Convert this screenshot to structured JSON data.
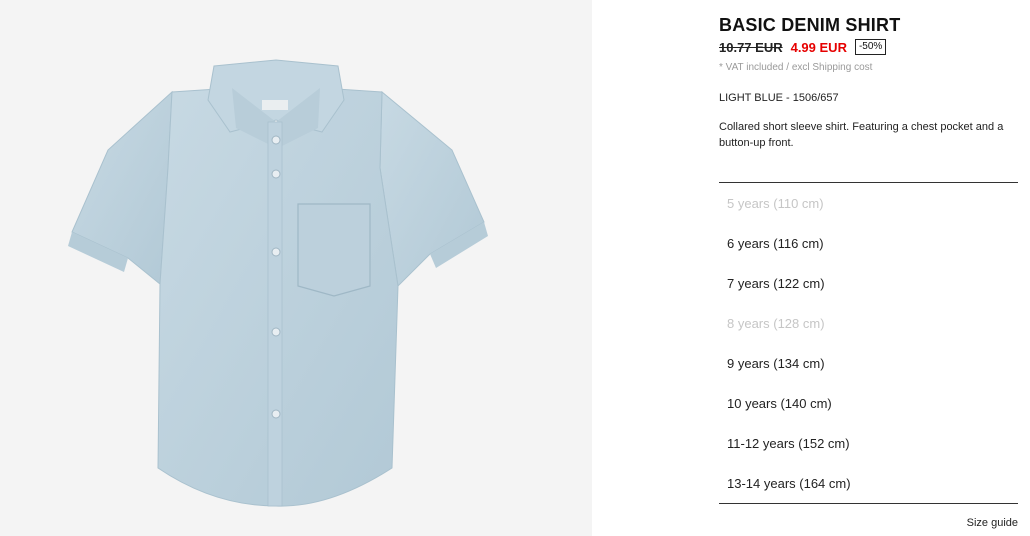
{
  "product": {
    "title": "BASIC DENIM SHIRT",
    "old_price": "10.77 EUR",
    "new_price": "4.99 EUR",
    "discount": "-50%",
    "vat_note": "* VAT included / excl Shipping cost",
    "color_ref": "LIGHT BLUE - 1506/657",
    "description": "Collared short sleeve shirt. Featuring a chest pocket and a button-up front."
  },
  "colors": {
    "sale_red": "#e60000",
    "unavailable_gray": "#c6c6c6",
    "image_bg": "#f4f4f4",
    "denim": "#bcd1dc"
  },
  "sizes": [
    {
      "label": "5 years (110 cm)",
      "available": false
    },
    {
      "label": "6 years (116 cm)",
      "available": true
    },
    {
      "label": "7 years (122 cm)",
      "available": true
    },
    {
      "label": "8 years (128 cm)",
      "available": false
    },
    {
      "label": "9 years (134 cm)",
      "available": true
    },
    {
      "label": "10 years (140 cm)",
      "available": true
    },
    {
      "label": "11-12 years (152 cm)",
      "available": true
    },
    {
      "label": "13-14 years (164 cm)",
      "available": true
    }
  ],
  "size_guide_label": "Size guide"
}
